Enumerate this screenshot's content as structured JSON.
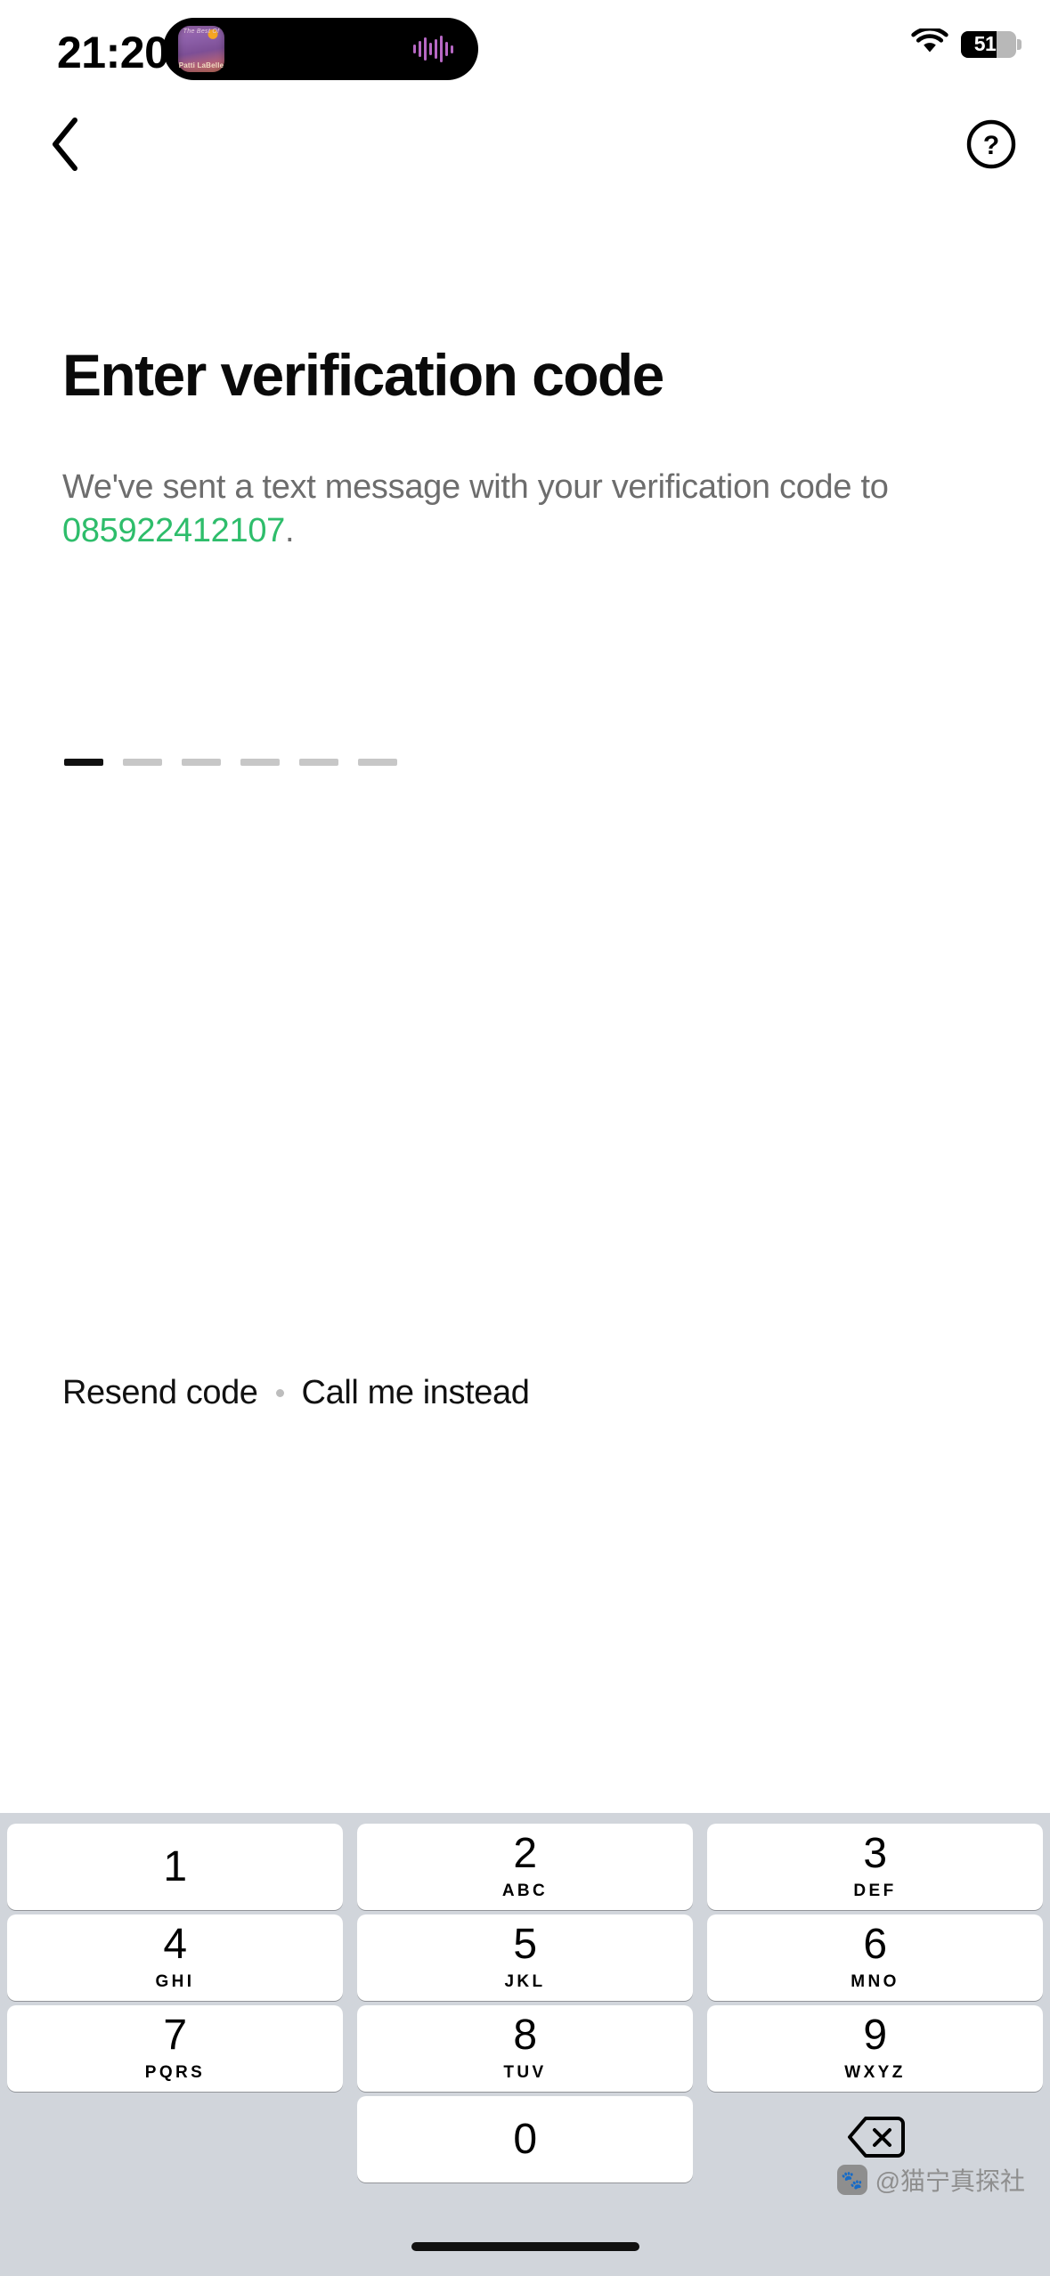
{
  "status_bar": {
    "time": "21:20",
    "battery_percent": "51",
    "battery_level": 51,
    "wifi_icon": "wifi-icon",
    "island": {
      "album_title_top": "The Best Of",
      "album_title_bottom": "Patti LaBelle",
      "waveform_icon": "audio-waveform-icon"
    }
  },
  "nav": {
    "back_icon": "chevron-left-icon",
    "help_icon": "question-mark-circle-icon"
  },
  "main": {
    "title": "Enter verification code",
    "subtitle_prefix": "We've sent a text message with your verification code to ",
    "phone_number": "085922412107",
    "subtitle_suffix": ".",
    "phone_number_color": "#2ebd6b",
    "code_length": 6,
    "code_filled": 0,
    "active_index": 0
  },
  "actions": {
    "resend_label": "Resend code",
    "separator_icon": "dot-separator-icon",
    "call_label": "Call me instead"
  },
  "keypad": {
    "keys": [
      {
        "digit": "1",
        "letters": ""
      },
      {
        "digit": "2",
        "letters": "ABC"
      },
      {
        "digit": "3",
        "letters": "DEF"
      },
      {
        "digit": "4",
        "letters": "GHI"
      },
      {
        "digit": "5",
        "letters": "JKL"
      },
      {
        "digit": "6",
        "letters": "MNO"
      },
      {
        "digit": "7",
        "letters": "PQRS"
      },
      {
        "digit": "8",
        "letters": "TUV"
      },
      {
        "digit": "9",
        "letters": "WXYZ"
      },
      {
        "digit": "0",
        "letters": ""
      }
    ],
    "delete_icon": "backspace-delete-icon",
    "background_color": "#d1d5db",
    "key_color": "#ffffff"
  },
  "watermark": {
    "text": "@猫宁真探社",
    "badge_icon": "paw-icon"
  }
}
